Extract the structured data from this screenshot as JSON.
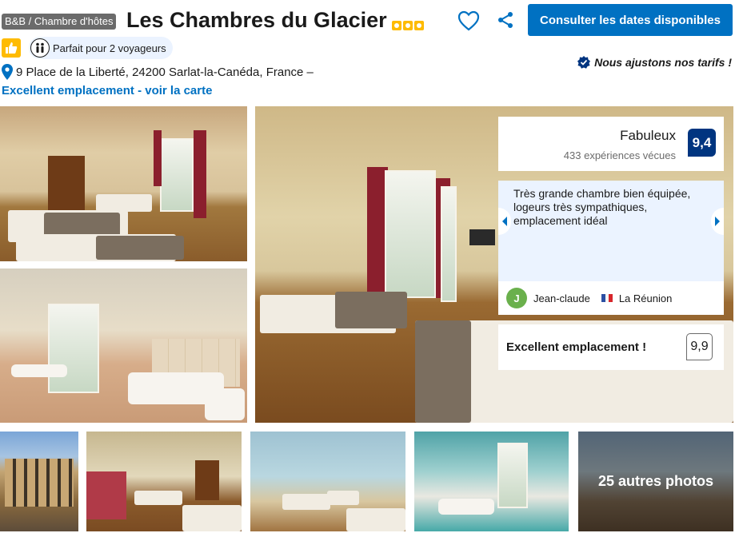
{
  "header": {
    "type_badge": "B&B / Chambre d'hôtes",
    "title": "Les Chambres du Glacier",
    "star_count": 3,
    "cta_label": "Consulter les dates disponibles",
    "travel_badge": "Parfait pour 2 voyageurs",
    "price_match": "Nous ajustons nos tarifs !",
    "address": "9 Place de la Liberté, 24200 Sarlat-la-Canéda, France –",
    "map_link": "Excellent emplacement - voir la carte"
  },
  "review_summary": {
    "score_word": "Fabuleux",
    "review_count": "433 expériences vécues",
    "score": "9,4",
    "quote": "Très grande chambre bien équipée, logeurs très sympathiques, emplacement idéal",
    "reviewer_initial": "J",
    "reviewer_name": "Jean-claude",
    "reviewer_country": "La Réunion",
    "location_label": "Excellent emplacement !",
    "location_score": "9,9"
  },
  "gallery": {
    "more_photos": "25 autres photos"
  },
  "colors": {
    "primary": "#0071c2",
    "score_badge": "#003580",
    "star": "#febb02",
    "review_bg": "#ebf3ff"
  },
  "icons": [
    "heart-icon",
    "share-icon",
    "thumbs-up-icon",
    "travellers-icon",
    "location-pin-icon",
    "checkmark-badge-icon",
    "chevron-left-icon",
    "chevron-right-icon"
  ]
}
